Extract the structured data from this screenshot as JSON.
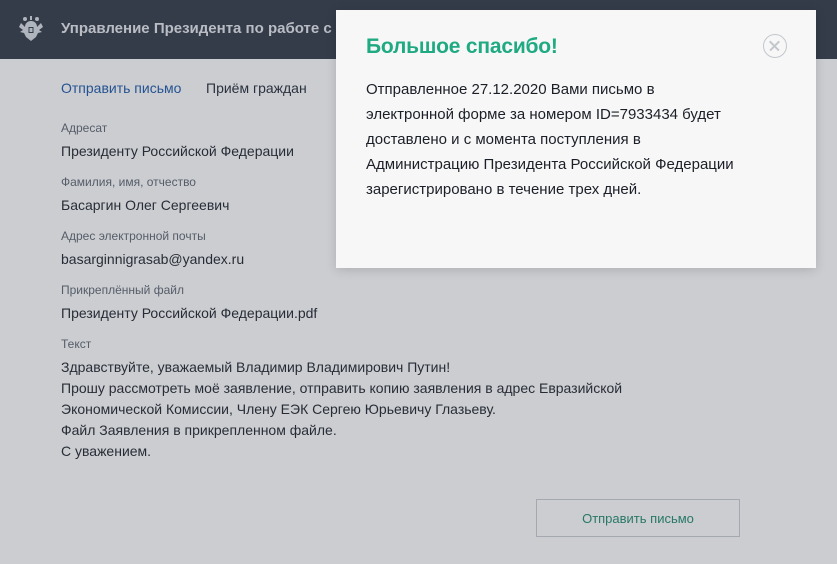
{
  "header": {
    "title": "Управление Президента по работе с обращениями граждан и организаций",
    "emblem_icon": "russian-coat-of-arms-emblem"
  },
  "nav": {
    "items": [
      {
        "label": "Отправить письмо",
        "active": true
      },
      {
        "label": "Приём граждан",
        "active": false
      }
    ]
  },
  "form": {
    "addressee": {
      "label": "Адресат",
      "value": "Президенту Российской Федерации"
    },
    "full_name": {
      "label": "Фамилия, имя, отчество",
      "value": "Басаргин Олег Сергеевич"
    },
    "email": {
      "label": "Адрес электронной почты",
      "value": "basarginnigrasab@yandex.ru"
    },
    "attachment": {
      "label": "Прикреплённый файл",
      "value": "Президенту Российской Федерации.pdf"
    },
    "text": {
      "label": "Текст",
      "lines": [
        "Здравствуйте, уважаемый Владимир Владимирович Путин!",
        "Прошу рассмотреть моё заявление, отправить копию заявления в адрес Евразийской",
        "Экономической Комиссии, Члену ЕЭК Сергею Юрьевичу Глазьеву.",
        "Файл Заявления в прикрепленном файле.",
        "С уважением."
      ]
    },
    "send_button_label": "Отправить письмо"
  },
  "modal": {
    "title": "Большое спасибо!",
    "close_icon": "close-circle-icon",
    "message_lines": [
      "Отправленное 27.12.2020 Вами письмо в",
      "электронной форме за номером ID=7933434 будет",
      "доставлено и с момента поступления в",
      "Администрацию Президента Российской Федерации",
      "зарегистрировано в течение трех дней."
    ]
  },
  "colors": {
    "header_bg": "#2f3745",
    "accent_green": "#1faa82",
    "nav_active": "#1a56a8"
  }
}
